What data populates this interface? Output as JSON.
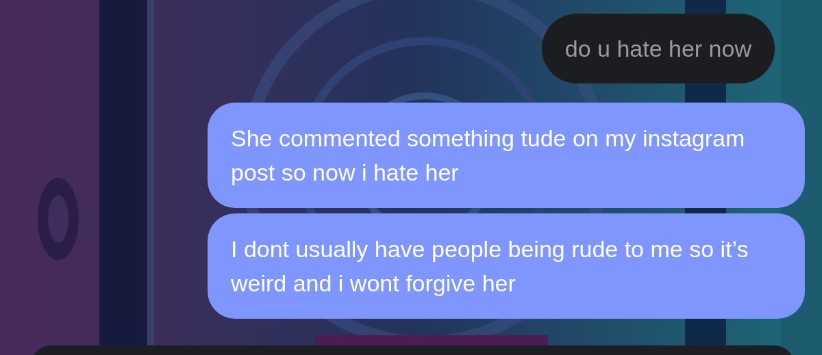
{
  "messages": [
    {
      "kind": "received",
      "text": "do u hate her now"
    },
    {
      "kind": "sent",
      "text": "She commented something tude on my instagram post so now i hate her"
    },
    {
      "kind": "sent",
      "text": "I dont usually have people being rude to me so it’s weird and i wont forgive her"
    }
  ]
}
